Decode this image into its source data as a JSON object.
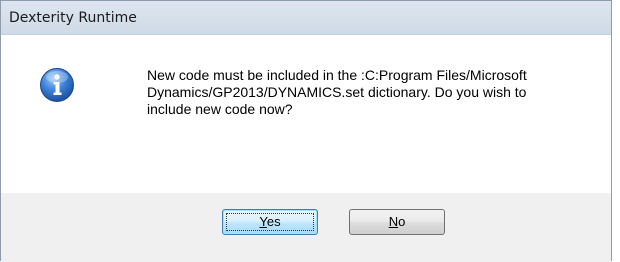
{
  "window": {
    "title": "Dexterity Runtime"
  },
  "message": {
    "icon": "info-icon",
    "text": "New code must be included in the :C:Program Files/Microsoft\nDynamics/GP2013/DYNAMICS.set dictionary.  Do you wish to\ninclude new code now?"
  },
  "buttons": {
    "yes": {
      "mnemonic": "Y",
      "rest": "es"
    },
    "no": {
      "mnemonic": "N",
      "rest": "o"
    }
  },
  "colors": {
    "info_icon": "#2f6fc4",
    "titlebar": "#d6e0eb",
    "default_button_border": "#3c7fb1"
  }
}
